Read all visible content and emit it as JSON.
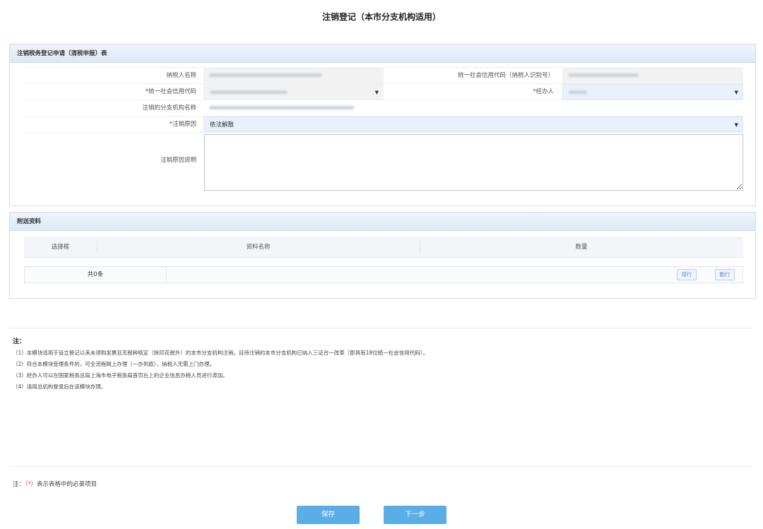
{
  "page": {
    "title": "注销登记（本市分支机构适用）"
  },
  "register_panel": {
    "title": "注销税务登记申请（清税申报）表",
    "fields": {
      "taxpayer_name_label": "纳税人名称",
      "credit_code_label": "统一社会信用代码（纳税人识别号）",
      "unified_code_label": "*统一社会信用代码",
      "handler_label": "*经办人",
      "branch_name_label": "注销的分支机构名称",
      "reason_label": "*注销原因",
      "reason_value": "依法解散",
      "reason_desc_label": "注销原因说明",
      "reason_desc_value": ""
    }
  },
  "attach_panel": {
    "title": "附送资料",
    "columns": [
      "选择框",
      "资料名称",
      "数量"
    ],
    "count_text": "共0条",
    "add_row_label": "增行",
    "delete_row_label": "删行"
  },
  "notes": {
    "heading": "注：",
    "items": [
      "（1）本模块适用于设立登记以来未领购发票且无税种核定（除印花税外）的本市分支机构注销，且待注销的本市分支机构已纳入三证合一改革（即具有18位统一社会信用代码）。",
      "（2）符合本模块受理条件的，可全流程网上办理（一办到底），纳税人无需上门办理。",
      "（3）经办人可以在国家税务总局上海市电子税务局首页右上的企业信息办税人员进行添加。",
      "（4）请用总机构登录后在该模块办理。"
    ]
  },
  "required_note": {
    "prefix": "注：",
    "star": "（*）",
    "suffix": "表示表格中的必录项目"
  },
  "buttons": {
    "save": "保存",
    "next": "下一步"
  },
  "colors": {
    "primary_button": "#5aaee8",
    "panel_header": "#dde9f6",
    "required_star": "#e0393e"
  }
}
